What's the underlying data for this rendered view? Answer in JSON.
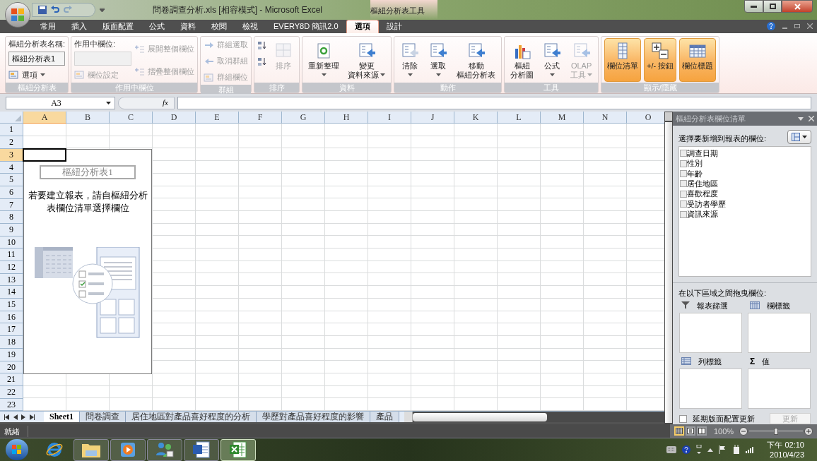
{
  "window": {
    "title": "問卷調查分析.xls [相容模式] - Microsoft Excel",
    "context_title": "樞紐分析表工具"
  },
  "tabs": [
    {
      "label": "常用",
      "selected": false
    },
    {
      "label": "插入",
      "selected": false
    },
    {
      "label": "版面配置",
      "selected": false
    },
    {
      "label": "公式",
      "selected": false
    },
    {
      "label": "資料",
      "selected": false
    },
    {
      "label": "校閱",
      "selected": false
    },
    {
      "label": "檢視",
      "selected": false
    },
    {
      "label": "EVERY8D 簡訊2.0",
      "selected": false
    },
    {
      "label": "選項",
      "selected": true
    },
    {
      "label": "設計",
      "selected": false
    }
  ],
  "ribbon": {
    "groups": [
      {
        "label": "樞紐分析表",
        "columns": [
          [
            {
              "kind": "label",
              "text": "樞紐分析表名稱:"
            },
            {
              "kind": "field",
              "value": "樞紐分析表1",
              "disabled": false
            },
            {
              "kind": "small",
              "text": "選項",
              "dropdown": true,
              "disabled": false
            }
          ]
        ]
      },
      {
        "label": "作用中欄位",
        "columns": [
          [
            {
              "kind": "label",
              "text": "作用中欄位:"
            },
            {
              "kind": "field",
              "disabled": true
            },
            {
              "kind": "small",
              "text": "欄位設定",
              "disabled": true
            }
          ],
          [
            {
              "kind": "small",
              "text": "展開整個欄位",
              "disabled": true
            },
            {
              "kind": "small",
              "text": "摺疊整個欄位",
              "disabled": true
            }
          ]
        ]
      },
      {
        "label": "群組",
        "columns": [
          [
            {
              "kind": "small",
              "text": "群組選取",
              "disabled": true
            },
            {
              "kind": "small",
              "text": "取消群組",
              "disabled": true
            },
            {
              "kind": "small",
              "text": "群組欄位",
              "disabled": true
            }
          ]
        ]
      },
      {
        "label": "排序",
        "columns": [
          [
            {
              "kind": "icon",
              "disabled": false
            },
            {
              "kind": "icon",
              "disabled": false
            }
          ],
          [
            {
              "kind": "large",
              "lines": [
                "排序"
              ],
              "disabled": true
            }
          ]
        ]
      },
      {
        "label": "資料",
        "columns": [
          [
            {
              "kind": "large",
              "lines": [
                "重新整理"
              ],
              "dropdown": true,
              "disabled": false
            }
          ],
          [
            {
              "kind": "large",
              "lines": [
                "變更",
                "資料來源"
              ],
              "dropdown": true,
              "disabled": false
            }
          ]
        ]
      },
      {
        "label": "動作",
        "columns": [
          [
            {
              "kind": "large",
              "lines": [
                "清除"
              ],
              "dropdown": true,
              "disabled": false
            }
          ],
          [
            {
              "kind": "large",
              "lines": [
                "選取"
              ],
              "dropdown": true,
              "disabled": false
            }
          ],
          [
            {
              "kind": "large",
              "lines": [
                "移動",
                "樞紐分析表"
              ],
              "disabled": false
            }
          ]
        ]
      },
      {
        "label": "工具",
        "columns": [
          [
            {
              "kind": "large",
              "lines": [
                "樞紐",
                "分析圖"
              ],
              "disabled": false
            }
          ],
          [
            {
              "kind": "large",
              "lines": [
                "公式"
              ],
              "dropdown": true,
              "disabled": false
            }
          ],
          [
            {
              "kind": "large",
              "lines": [
                "OLAP",
                "工具"
              ],
              "dropdown": true,
              "disabled": true
            }
          ]
        ]
      },
      {
        "label": "顯示/隱藏",
        "columns": [
          [
            {
              "kind": "toggle",
              "lines": [
                "欄位清單"
              ],
              "on": true
            }
          ],
          [
            {
              "kind": "toggle",
              "lines": [
                "+/- 按鈕"
              ],
              "on": true
            }
          ],
          [
            {
              "kind": "toggle",
              "lines": [
                "欄位標題"
              ],
              "on": true
            }
          ]
        ]
      }
    ]
  },
  "formula_bar": {
    "name_box": "A3",
    "function_label": "fx"
  },
  "sheet": {
    "columns": [
      {
        "label": "A",
        "selected": true
      },
      {
        "label": "B",
        "selected": false
      },
      {
        "label": "C",
        "selected": false
      },
      {
        "label": "D",
        "selected": false
      },
      {
        "label": "E",
        "selected": false
      },
      {
        "label": "F",
        "selected": false
      },
      {
        "label": "G",
        "selected": false
      },
      {
        "label": "H",
        "selected": false
      },
      {
        "label": "I",
        "selected": false
      },
      {
        "label": "J",
        "selected": false
      },
      {
        "label": "K",
        "selected": false
      },
      {
        "label": "L",
        "selected": false
      },
      {
        "label": "M",
        "selected": false
      },
      {
        "label": "N",
        "selected": false
      },
      {
        "label": "O",
        "selected": false
      }
    ],
    "rows": [
      {
        "label": "1",
        "selected": false
      },
      {
        "label": "2",
        "selected": false
      },
      {
        "label": "3",
        "selected": true
      },
      {
        "label": "4",
        "selected": false
      },
      {
        "label": "5",
        "selected": false
      },
      {
        "label": "6",
        "selected": false
      },
      {
        "label": "7",
        "selected": false
      },
      {
        "label": "8",
        "selected": false
      },
      {
        "label": "9",
        "selected": false
      },
      {
        "label": "10",
        "selected": false
      },
      {
        "label": "11",
        "selected": false
      },
      {
        "label": "12",
        "selected": false
      },
      {
        "label": "13",
        "selected": false
      },
      {
        "label": "14",
        "selected": false
      },
      {
        "label": "15",
        "selected": false
      },
      {
        "label": "16",
        "selected": false
      },
      {
        "label": "17",
        "selected": false
      },
      {
        "label": "18",
        "selected": false
      },
      {
        "label": "19",
        "selected": false
      },
      {
        "label": "20",
        "selected": false
      },
      {
        "label": "21",
        "selected": false
      },
      {
        "label": "22",
        "selected": false
      },
      {
        "label": "23",
        "selected": false
      }
    ],
    "pivot_placeholder": {
      "name": "樞紐分析表1",
      "message": "若要建立報表，請自樞紐分析表欄位清單選擇欄位"
    }
  },
  "sheet_tabs": [
    {
      "label": "Sheet1",
      "selected": true
    },
    {
      "label": "問卷調查",
      "selected": false
    },
    {
      "label": "居住地區對產品喜好程度的分析",
      "selected": false
    },
    {
      "label": "學歷對產品喜好程度的影響",
      "selected": false
    },
    {
      "label": "產品",
      "selected": false
    }
  ],
  "field_list": {
    "title": "樞紐分析表欄位清單",
    "choose_label": "選擇要新增到報表的欄位:",
    "fields": [
      {
        "label": "調查日期",
        "checked": false
      },
      {
        "label": "性別",
        "checked": false
      },
      {
        "label": "年齡",
        "checked": false
      },
      {
        "label": "居住地區",
        "checked": false
      },
      {
        "label": "喜歡程度",
        "checked": false
      },
      {
        "label": "受訪者學歷",
        "checked": false
      },
      {
        "label": "資訊來源",
        "checked": false
      }
    ],
    "drag_label": "在以下區域之間拖曳欄位:",
    "areas": [
      {
        "kind": "filter",
        "label": "報表篩選"
      },
      {
        "kind": "columns",
        "label": "欄標籤"
      },
      {
        "kind": "rows",
        "label": "列標籤"
      },
      {
        "kind": "values",
        "symbol": "Σ",
        "label": "值"
      }
    ],
    "defer": {
      "label": "延期版面配置更新",
      "checked": false
    },
    "update_button": {
      "label": "更新",
      "disabled": true
    }
  },
  "status_bar": {
    "status": "就緒",
    "views": [
      {
        "kind": "normal",
        "selected": true
      },
      {
        "kind": "layout",
        "selected": false
      },
      {
        "kind": "break",
        "selected": false
      }
    ],
    "zoom": "100%",
    "zoom_slider": {
      "level": 0.5
    }
  },
  "taskbar": {
    "apps": [
      {
        "kind": "ie",
        "active": false
      },
      {
        "kind": "folder",
        "active": false
      },
      {
        "kind": "media",
        "active": false
      },
      {
        "kind": "people",
        "active": false
      },
      {
        "kind": "word",
        "active": false
      },
      {
        "kind": "excel",
        "active": true
      }
    ],
    "time": "下午 02:10",
    "date": "2010/4/23"
  }
}
